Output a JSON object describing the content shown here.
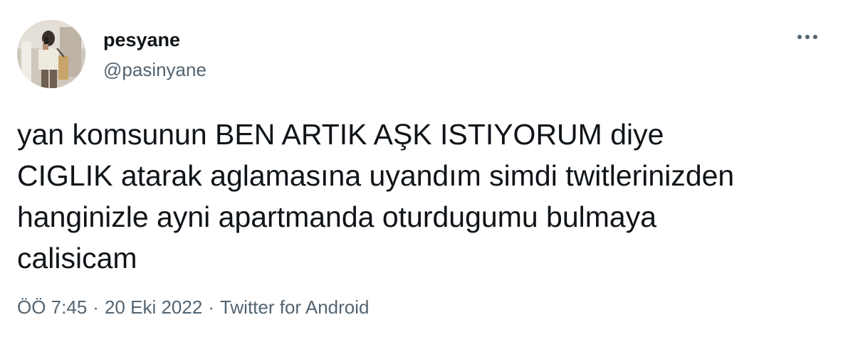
{
  "author": {
    "display_name": "pesyane",
    "handle": "@pasinyane",
    "avatar_icon": "profile-photo"
  },
  "more_icon": "more-horizontal-icon",
  "tweet": {
    "lines": [
      "yan komsunun BEN ARTIK AŞK ISTIYORUM diye",
      "CIGLIK atarak aglamasına uyandım simdi twitlerinizden",
      "hanginizle ayni apartmanda oturdugumu bulmaya",
      "calisicam"
    ]
  },
  "meta": {
    "time": "ÖÖ 7:45",
    "separator": "·",
    "date": "20 Eki 2022",
    "source": "Twitter for Android"
  },
  "colors": {
    "text": "#0f1419",
    "secondary": "#536471"
  }
}
